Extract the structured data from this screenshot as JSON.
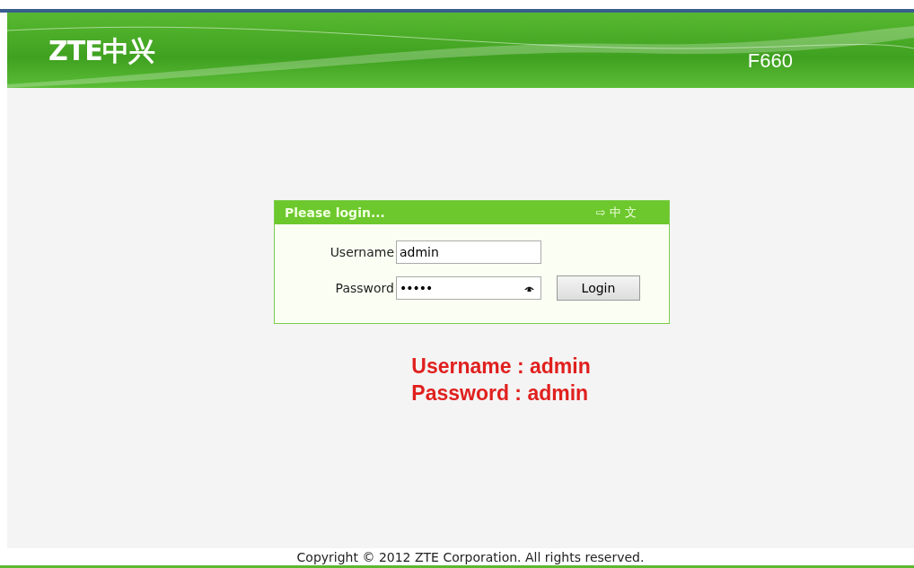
{
  "header": {
    "logo": "ZTE中兴",
    "model": "F660"
  },
  "login_panel": {
    "title": "Please login...",
    "language_link": {
      "arrow": "⇨",
      "label": "中 文"
    },
    "fields": [
      {
        "label": "Username",
        "value": "admin",
        "kind": "text"
      },
      {
        "label": "Password",
        "value": "•••••",
        "kind": "password"
      }
    ],
    "button": "Login"
  },
  "note": [
    "Username : admin",
    "Password : admin"
  ],
  "footer": "Copyright © 2012 ZTE Corporation. All rights reserved."
}
